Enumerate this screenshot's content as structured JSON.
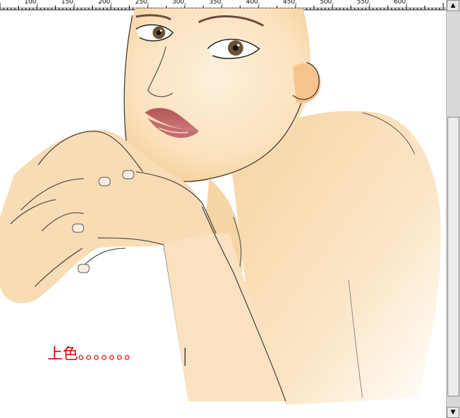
{
  "ruler": {
    "labels": [
      "100",
      "150",
      "200",
      "250",
      "300",
      "350",
      "400",
      "450",
      "500",
      "550",
      "600"
    ]
  },
  "canvas": {
    "caption": "上色。。。。。。。"
  },
  "scrollbar": {
    "up_icon": "arrow-up-icon",
    "down_icon": "arrow-down-icon"
  },
  "colors": {
    "caption": "#d40000",
    "skin": "#fbe4c2",
    "lips": "#b85c5c"
  }
}
